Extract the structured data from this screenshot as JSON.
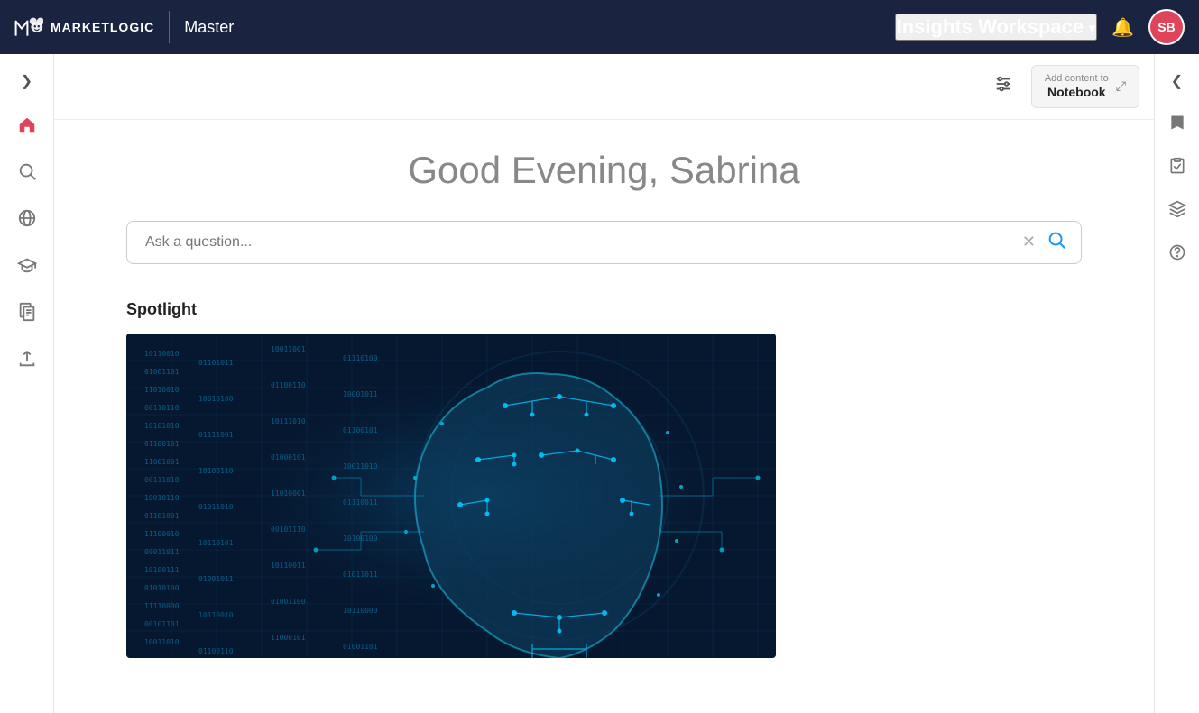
{
  "app": {
    "logo_text": "MARKETLOGIC",
    "master_label": "Master",
    "insights_workspace": "Insights Workspace",
    "user_initials": "SB",
    "user_avatar_color": "#e0445a"
  },
  "toolbar": {
    "add_content_line1": "Add content to",
    "add_content_line2": "Notebook"
  },
  "main": {
    "greeting": "Good Evening, Sabrina",
    "search_placeholder": "Ask a question...",
    "spotlight_label": "Spotlight"
  },
  "left_sidebar": {
    "items": [
      {
        "id": "home",
        "icon": "🏠",
        "active": true
      },
      {
        "id": "search",
        "icon": "🔍",
        "active": false
      },
      {
        "id": "globe",
        "icon": "🌐",
        "active": false
      },
      {
        "id": "graduation",
        "icon": "🎓",
        "active": false
      },
      {
        "id": "document",
        "icon": "📋",
        "active": false
      },
      {
        "id": "upload",
        "icon": "⬆",
        "active": false
      }
    ]
  },
  "right_sidebar": {
    "items": [
      {
        "id": "bookmark",
        "icon": "🔖"
      },
      {
        "id": "clipboard",
        "icon": "📋"
      },
      {
        "id": "stack",
        "icon": "📚"
      },
      {
        "id": "help",
        "icon": "❓"
      }
    ]
  },
  "colors": {
    "nav_bg": "#1a2340",
    "accent_red": "#e0445a",
    "accent_blue": "#2196f3",
    "sidebar_bg": "#ffffff",
    "content_bg": "#ffffff"
  }
}
